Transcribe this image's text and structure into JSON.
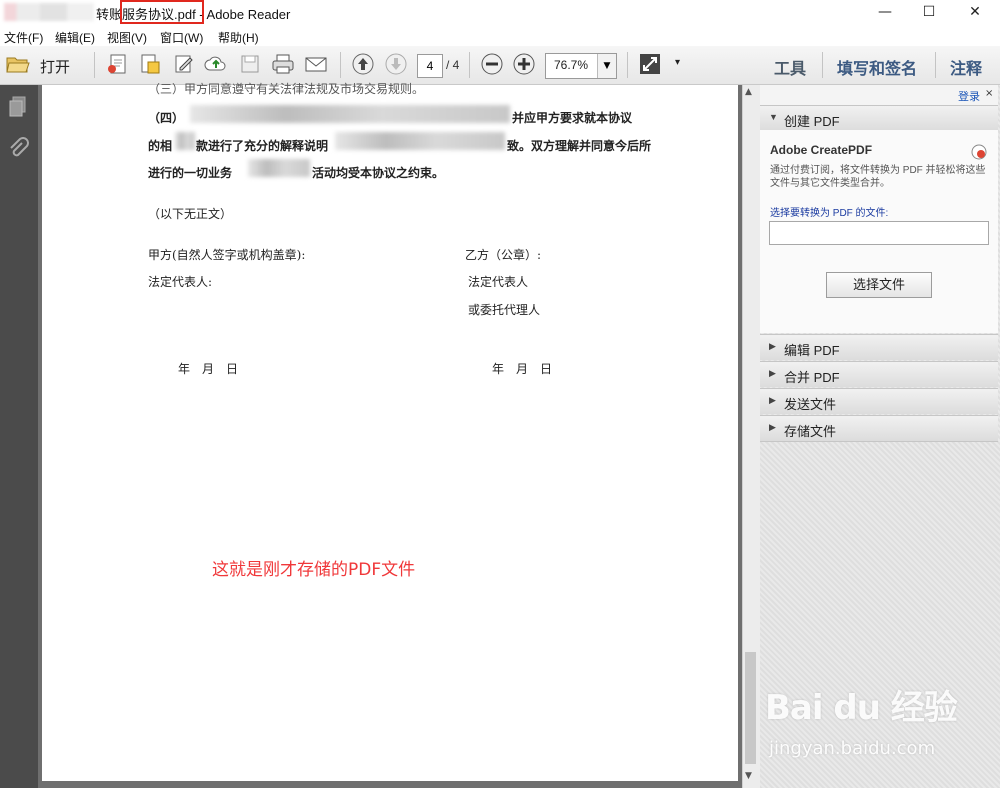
{
  "window": {
    "title": "转账服务协议.pdf - Adobe Reader",
    "title_visible": "转账服务协议.pdf - Adobe Reader",
    "controls": {
      "minimize": "—",
      "maximize": "☐",
      "close": "✕"
    }
  },
  "menu": [
    "文件(F)",
    "编辑(E)",
    "视图(V)",
    "窗口(W)",
    "帮助(H)"
  ],
  "toolbar": {
    "open_label": "打开",
    "page_current": "4",
    "page_total": "/ 4",
    "zoom": "76.7%",
    "groups": [
      "工具",
      "填写和签名",
      "注释"
    ]
  },
  "document": {
    "line1": "（三）甲方同意遵守有关法律法规及市场交易规则。",
    "line2_start": "（四）",
    "line2_end": "并应甲方要求就本协议",
    "line3_start": "的相",
    "line3_mid": "款进行了充分的解释说明",
    "line3_end": "致。双方理解并同意今后所",
    "line4_start": "进行的一切业务",
    "line4_end": "活动均受本协议之约束。",
    "no_body": "（以下无正文）",
    "party_a": "甲方(自然人签字或机构盖章):",
    "party_b": "乙方（公章）:",
    "rep_a": "法定代表人:",
    "rep_b": "法定代表人",
    "agent_b": "或委托代理人",
    "date_a": "年　月　日",
    "date_b": "年　月　日",
    "annotation": "这就是刚才存储的PDF文件"
  },
  "right_panel": {
    "login": "登录",
    "create_pdf": {
      "header": "创建 PDF",
      "title": "Adobe CreatePDF",
      "description": "通过付费订阅，将文件转换为 PDF 并轻松将这些文件与其它文件类型合并。",
      "pick_label": "选择要转换为 PDF 的文件:",
      "button": "选择文件"
    },
    "sections": [
      "编辑 PDF",
      "合并 PDF",
      "发送文件",
      "存储文件"
    ]
  },
  "watermark": {
    "main": "Bai du 经验",
    "sub": "jingyan.baidu.com"
  },
  "colors": {
    "annotation": "#f0383a",
    "highlight_border": "#e0281e",
    "link": "#1a55b8"
  }
}
